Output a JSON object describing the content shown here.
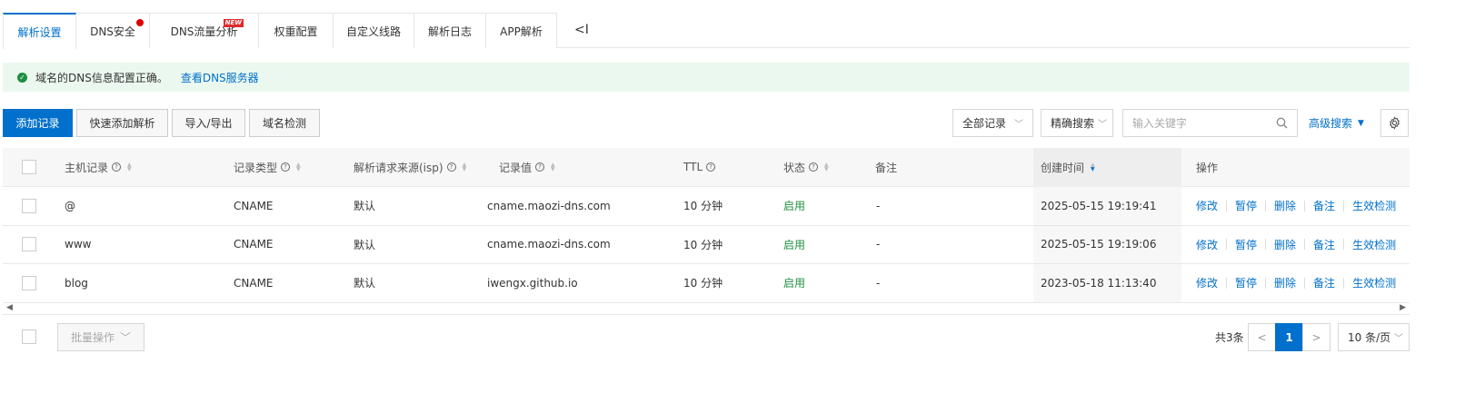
{
  "tabs": [
    {
      "label": "解析设置",
      "active": true,
      "badge": ""
    },
    {
      "label": "DNS安全",
      "active": false,
      "badge": "dot"
    },
    {
      "label": "DNS流量分析",
      "active": false,
      "badge": "NEW"
    },
    {
      "label": "权重配置",
      "active": false,
      "badge": ""
    },
    {
      "label": "自定义线路",
      "active": false,
      "badge": ""
    },
    {
      "label": "解析日志",
      "active": false,
      "badge": ""
    },
    {
      "label": "APP解析",
      "active": false,
      "badge": ""
    }
  ],
  "tab_collapse_label": "<I",
  "notice": {
    "message": "域名的DNS信息配置正确。",
    "link": "查看DNS服务器"
  },
  "toolbar": {
    "add_record": "添加记录",
    "quick_add": "快速添加解析",
    "import_export": "导入/导出",
    "domain_check": "域名检测",
    "record_filter": "全部记录",
    "search_mode": "精确搜索",
    "search_placeholder": "输入关键字",
    "advanced_search": "高级搜索"
  },
  "table": {
    "headers": {
      "host": "主机记录",
      "type": "记录类型",
      "isp": "解析请求来源(isp)",
      "value": "记录值",
      "ttl": "TTL",
      "status": "状态",
      "remark": "备注",
      "created": "创建时间",
      "actions": "操作"
    },
    "rows": [
      {
        "host": "@",
        "type": "CNAME",
        "isp": "默认",
        "value": "cname.maozi-dns.com",
        "ttl": "10 分钟",
        "status": "启用",
        "remark": "-",
        "created": "2025-05-15 19:19:41"
      },
      {
        "host": "www",
        "type": "CNAME",
        "isp": "默认",
        "value": "cname.maozi-dns.com",
        "ttl": "10 分钟",
        "status": "启用",
        "remark": "-",
        "created": "2025-05-15 19:19:06"
      },
      {
        "host": "blog",
        "type": "CNAME",
        "isp": "默认",
        "value": "iwengx.github.io",
        "ttl": "10 分钟",
        "status": "启用",
        "remark": "-",
        "created": "2023-05-18 11:13:40"
      }
    ],
    "actions": [
      "修改",
      "暂停",
      "删除",
      "备注",
      "生效检测"
    ]
  },
  "footer": {
    "batch": "批量操作",
    "total": "共3条",
    "current_page": "1",
    "page_size": "10 条/页"
  },
  "colors": {
    "accent": "#0070cc",
    "success": "#1e8e3e",
    "notice_bg": "#ebf8ef"
  }
}
